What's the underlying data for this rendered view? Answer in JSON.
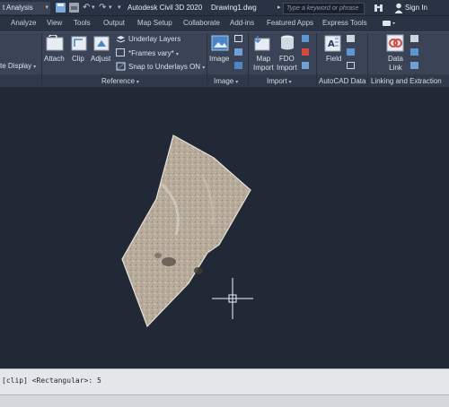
{
  "titlebar": {
    "workspace": "t Analysis",
    "app_title": "Autodesk Civil 3D 2020",
    "file_name": "Drawing1.dwg",
    "search_placeholder": "Type a keyword or phrase",
    "sign_in": "Sign In"
  },
  "tabs": [
    "Analyze",
    "View",
    "Tools",
    "Output",
    "Map Setup",
    "Collaborate",
    "Add-ins",
    "Featured Apps",
    "Express Tools"
  ],
  "ribbon": {
    "display_stub": "te Display",
    "reference": {
      "attach": "Attach",
      "clip": "Clip",
      "adjust": "Adjust",
      "underlay_layers": "Underlay Layers",
      "frames": "*Frames vary*",
      "snap": "Snap to Underlays ON",
      "label": "Reference"
    },
    "image": {
      "image": "Image",
      "label": "Image"
    },
    "import": {
      "map_import_line1": "Map",
      "map_import_line2": "Import",
      "fdo_import_line1": "FDO",
      "fdo_import_line2": "Import",
      "label": "Import"
    },
    "autocad_data": {
      "field": "Field",
      "label": "AutoCAD Data"
    },
    "linking": {
      "data_link_line1": "Data",
      "data_link_line2": "Link",
      "label": "Linking and Extraction"
    }
  },
  "command_line": {
    "text": "[clip] <Rectangular>: 5"
  },
  "colors": {
    "ribbon_bg": "#3a4456",
    "canvas_bg": "#212836",
    "command_bg": "#e4e6ea"
  }
}
